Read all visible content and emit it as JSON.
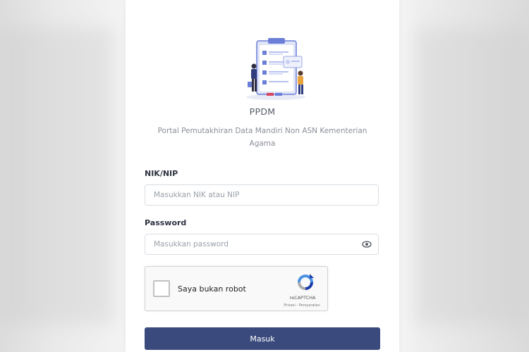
{
  "app": {
    "title": "PPDM",
    "subtitle": "Portal Pemutakhiran Data Mandiri Non ASN Kementerian Agama"
  },
  "form": {
    "nik_label": "NIK/NIP",
    "nik_placeholder": "Masukkan NIK atau NIP",
    "nik_value": "",
    "password_label": "Password",
    "password_placeholder": "Masukkan password",
    "password_value": "",
    "password_toggle_icon": "eye-icon",
    "submit_label": "Masuk"
  },
  "recaptcha": {
    "label": "Saya bukan robot",
    "brand": "reCAPTCHA",
    "links": "Privasi - Persyaratan",
    "checked": false
  },
  "colors": {
    "primary": "#3b4a7d",
    "illustration_blue": "#6c7fd8",
    "text_muted": "#8a8f99"
  }
}
